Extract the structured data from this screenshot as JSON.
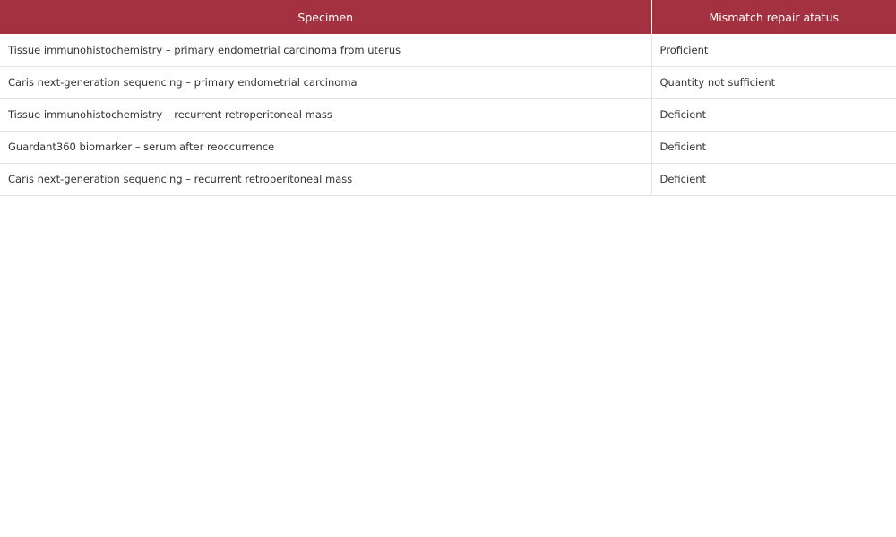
{
  "table": {
    "headers": [
      "Specimen",
      "Mismatch repair atatus"
    ],
    "rows": [
      [
        "Tissue immunohistochemistry – primary endometrial carcinoma from uterus",
        "Proficient"
      ],
      [
        "Caris next-generation sequencing – primary endometrial carcinoma",
        "Quantity not sufficient"
      ],
      [
        "Tissue immunohistochemistry – recurrent retroperitoneal mass",
        "Deficient"
      ],
      [
        "Guardant360 biomarker – serum after reoccurrence",
        "Deficient"
      ],
      [
        "Caris next-generation sequencing – recurrent retroperitoneal mass",
        "Deficient"
      ]
    ]
  },
  "colors": {
    "header_bg": "#a3313f",
    "header_text": "#ffffff",
    "cell_text": "#333333",
    "divider": "#e4e4e4"
  }
}
